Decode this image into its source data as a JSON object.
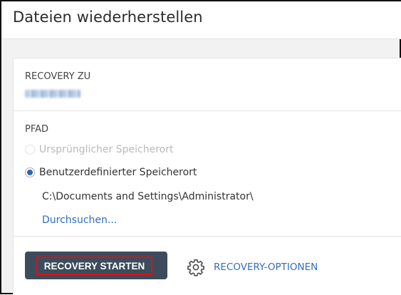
{
  "window": {
    "title": "Dateien wiederherstellen"
  },
  "recovery": {
    "label": "RECOVERY ZU"
  },
  "path": {
    "label": "PFAD",
    "options": [
      {
        "label": "Ursprünglicher Speicherort",
        "selected": false,
        "disabled": true
      },
      {
        "label": "Benutzerdefinierter Speicherort",
        "selected": true,
        "disabled": false
      }
    ],
    "value": "C:\\Documents and Settings\\Administrator\\",
    "browse_label": "Durchsuchen..."
  },
  "actions": {
    "start_label": "RECOVERY STARTEN",
    "options_label": "RECOVERY-OPTIONEN",
    "options_icon": "gear-icon"
  },
  "colors": {
    "accent": "#2f6ec2",
    "button_bg": "#3d4c5c",
    "highlight_border": "#dd1111"
  }
}
